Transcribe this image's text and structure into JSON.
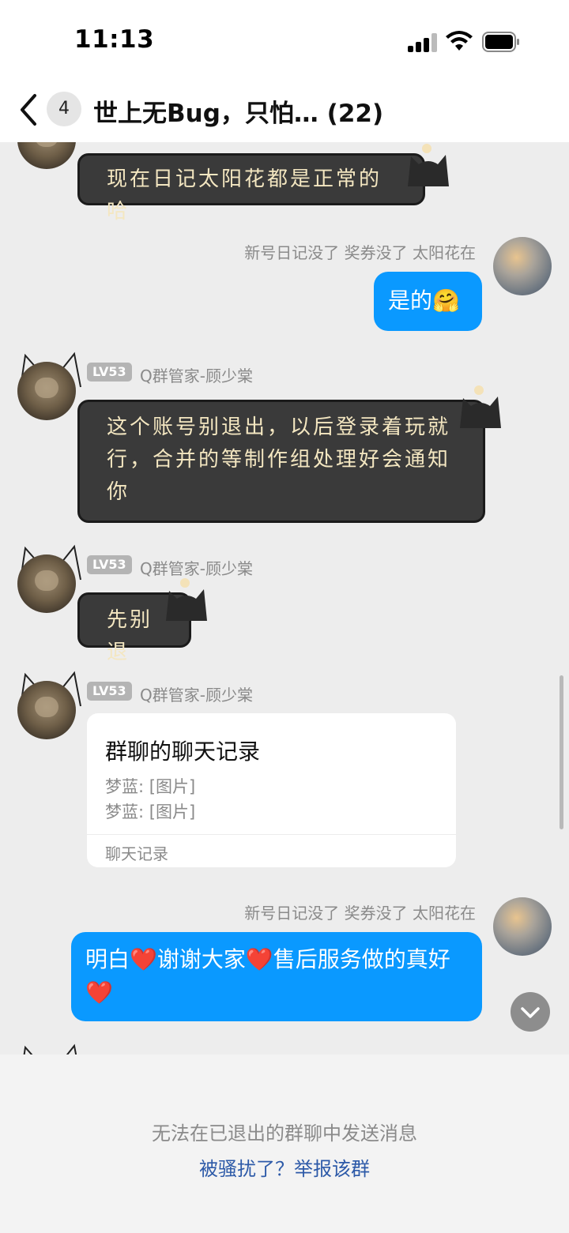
{
  "status_bar": {
    "time": "11:13"
  },
  "nav": {
    "unread_count": "4",
    "title": "世上无Bug，只怕… (22)"
  },
  "messages": [
    {
      "type": "dark",
      "sender": "",
      "text": "现在日记太阳花都是正常的哈"
    },
    {
      "type": "mine",
      "sender": "新号日记没了 奖券没了 太阳花在",
      "text": "是的🤗"
    },
    {
      "type": "dark",
      "level": "LV53",
      "sender": "Q群管家-顾少棠",
      "text": "这个账号别退出，以后登录着玩就行，合并的等制作组处理好会通知你"
    },
    {
      "type": "dark",
      "level": "LV53",
      "sender": "Q群管家-顾少棠",
      "text": "先别退"
    },
    {
      "type": "card",
      "level": "LV53",
      "sender": "Q群管家-顾少棠",
      "card": {
        "title": "群聊的聊天记录",
        "lines": [
          "梦蓝: [图片]",
          "梦蓝: [图片]"
        ],
        "footer": "聊天记录"
      }
    },
    {
      "type": "mine",
      "sender": "新号日记没了 奖券没了 太阳花在",
      "text": "明白❤️谢谢大家❤️售后服务做的真好❤️"
    }
  ],
  "footer": {
    "message": "无法在已退出的群聊中发送消息",
    "report_link": "被骚扰了？举报该群"
  },
  "colors": {
    "accent": "#0a99ff",
    "link": "#2d5aa8",
    "dark_bubble": "#3a3a3a",
    "dark_bubble_text": "#f4e7c1"
  },
  "icons": [
    "back-icon",
    "signal-icon",
    "wifi-icon",
    "battery-icon",
    "chevron-down-icon"
  ]
}
